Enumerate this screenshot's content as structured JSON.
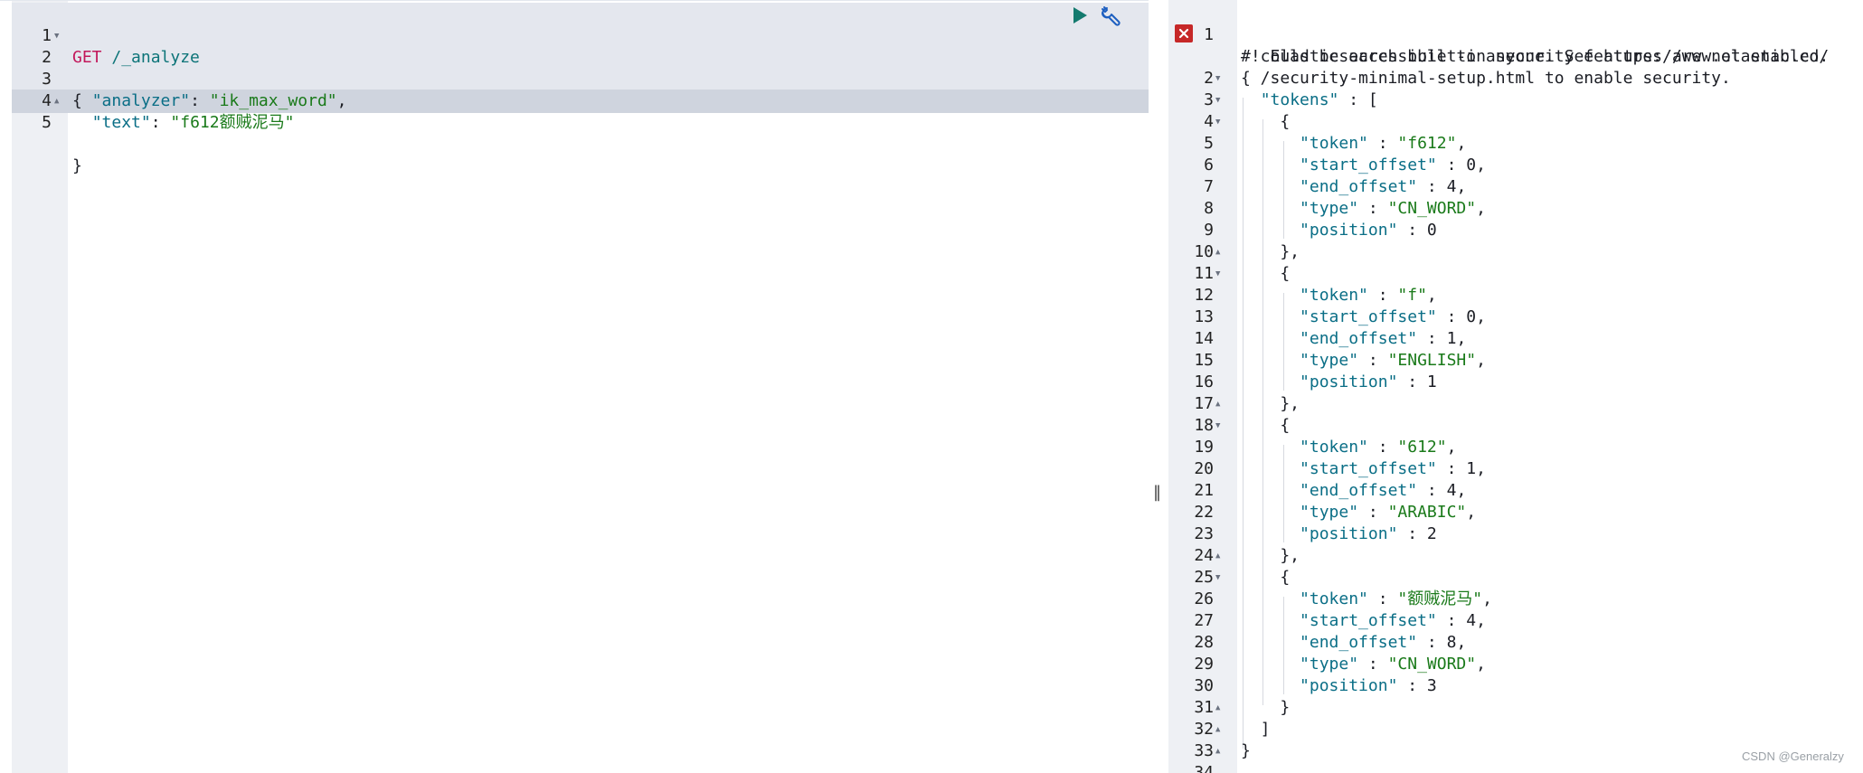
{
  "request": {
    "method": "GET",
    "path": "/_analyze",
    "lines": [
      {
        "num": "1",
        "fold": ""
      },
      {
        "num": "2",
        "fold": "▼",
        "text": "{"
      },
      {
        "num": "3",
        "fold": "",
        "key": "\"analyzer\"",
        "sep": ": ",
        "value": "\"ik_max_word\"",
        "tail": ","
      },
      {
        "num": "4",
        "fold": "",
        "key": "\"text\"",
        "sep": ": ",
        "value": "\"f612额贼泥马\"",
        "tail": ""
      },
      {
        "num": "5",
        "fold": "▲",
        "text": "}"
      }
    ]
  },
  "response": {
    "warning": [
      "#! Elasticsearch built-in security features are not enabled.",
      "  could be accessible to anyone. See https://www.elastic.co/",
      "  /security-minimal-setup.html to enable security."
    ],
    "lines": [
      {
        "num": "2",
        "fold": "▼",
        "text": "{"
      },
      {
        "num": "3",
        "fold": "▼",
        "text": "  \"tokens\" : ["
      },
      {
        "num": "4",
        "fold": "▼",
        "text": "    {"
      },
      {
        "num": "5",
        "fold": "",
        "text": "      \"token\" : \"f612\","
      },
      {
        "num": "6",
        "fold": "",
        "text": "      \"start_offset\" : 0,"
      },
      {
        "num": "7",
        "fold": "",
        "text": "      \"end_offset\" : 4,"
      },
      {
        "num": "8",
        "fold": "",
        "text": "      \"type\" : \"CN_WORD\","
      },
      {
        "num": "9",
        "fold": "",
        "text": "      \"position\" : 0"
      },
      {
        "num": "10",
        "fold": "▲",
        "text": "    },"
      },
      {
        "num": "11",
        "fold": "▼",
        "text": "    {"
      },
      {
        "num": "12",
        "fold": "",
        "text": "      \"token\" : \"f\","
      },
      {
        "num": "13",
        "fold": "",
        "text": "      \"start_offset\" : 0,"
      },
      {
        "num": "14",
        "fold": "",
        "text": "      \"end_offset\" : 1,"
      },
      {
        "num": "15",
        "fold": "",
        "text": "      \"type\" : \"ENGLISH\","
      },
      {
        "num": "16",
        "fold": "",
        "text": "      \"position\" : 1"
      },
      {
        "num": "17",
        "fold": "▲",
        "text": "    },"
      },
      {
        "num": "18",
        "fold": "▼",
        "text": "    {"
      },
      {
        "num": "19",
        "fold": "",
        "text": "      \"token\" : \"612\","
      },
      {
        "num": "20",
        "fold": "",
        "text": "      \"start_offset\" : 1,"
      },
      {
        "num": "21",
        "fold": "",
        "text": "      \"end_offset\" : 4,"
      },
      {
        "num": "22",
        "fold": "",
        "text": "      \"type\" : \"ARABIC\","
      },
      {
        "num": "23",
        "fold": "",
        "text": "      \"position\" : 2"
      },
      {
        "num": "24",
        "fold": "▲",
        "text": "    },"
      },
      {
        "num": "25",
        "fold": "▼",
        "text": "    {"
      },
      {
        "num": "26",
        "fold": "",
        "text": "      \"token\" : \"额贼泥马\","
      },
      {
        "num": "27",
        "fold": "",
        "text": "      \"start_offset\" : 4,"
      },
      {
        "num": "28",
        "fold": "",
        "text": "      \"end_offset\" : 8,"
      },
      {
        "num": "29",
        "fold": "",
        "text": "      \"type\" : \"CN_WORD\","
      },
      {
        "num": "30",
        "fold": "",
        "text": "      \"position\" : 3"
      },
      {
        "num": "31",
        "fold": "▲",
        "text": "    }"
      },
      {
        "num": "32",
        "fold": "▲",
        "text": "  ]"
      },
      {
        "num": "33",
        "fold": "▲",
        "text": "}"
      },
      {
        "num": "34",
        "fold": "",
        "text": ""
      }
    ]
  },
  "watermark": "CSDN @Generalzy",
  "colors": {
    "method": "#c2185b",
    "path": "#0c7478",
    "key": "#0a6e86",
    "string": "#1a7a1a",
    "run": "#137a6e",
    "error_marker": "#c62828"
  },
  "icons": {
    "run": "play-icon",
    "settings": "wrench-icon",
    "error": "close-icon",
    "splitter": "resize-grip-icon"
  }
}
